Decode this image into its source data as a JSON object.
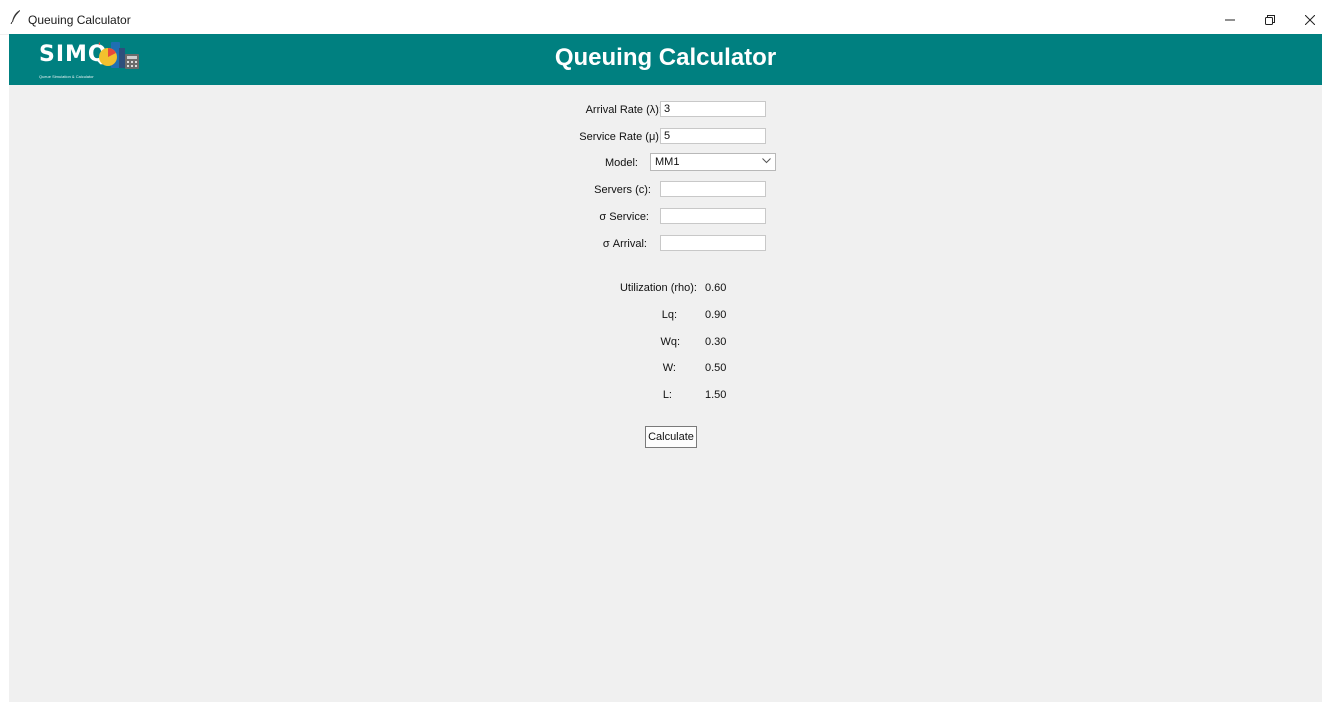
{
  "window": {
    "title": "Queuing Calculator",
    "controls": [
      "minimize-icon",
      "restore-icon",
      "close-icon"
    ]
  },
  "header": {
    "logo_text": "SIMQ",
    "logo_tagline": "Queue Simulation & Calculator",
    "title": "Queuing Calculator",
    "background": "#008080"
  },
  "form": {
    "arrival_rate": {
      "label": "Arrival Rate (λ):",
      "value": "3"
    },
    "service_rate": {
      "label": "Service Rate (μ):",
      "value": "5"
    },
    "model": {
      "label": "Model:",
      "selected": "MM1"
    },
    "servers": {
      "label": "Servers (c):",
      "value": ""
    },
    "sigma_service": {
      "label": "σ Service:",
      "value": ""
    },
    "sigma_arrival": {
      "label": "σ Arrival:",
      "value": ""
    }
  },
  "results": [
    {
      "label": "Utilization (rho):",
      "value": "0.60"
    },
    {
      "label": "Lq:",
      "value": "0.90"
    },
    {
      "label": "Wq:",
      "value": "0.30"
    },
    {
      "label": "W:",
      "value": "0.50"
    },
    {
      "label": "L:",
      "value": "1.50"
    }
  ],
  "actions": {
    "calculate_label": "Calculate"
  }
}
